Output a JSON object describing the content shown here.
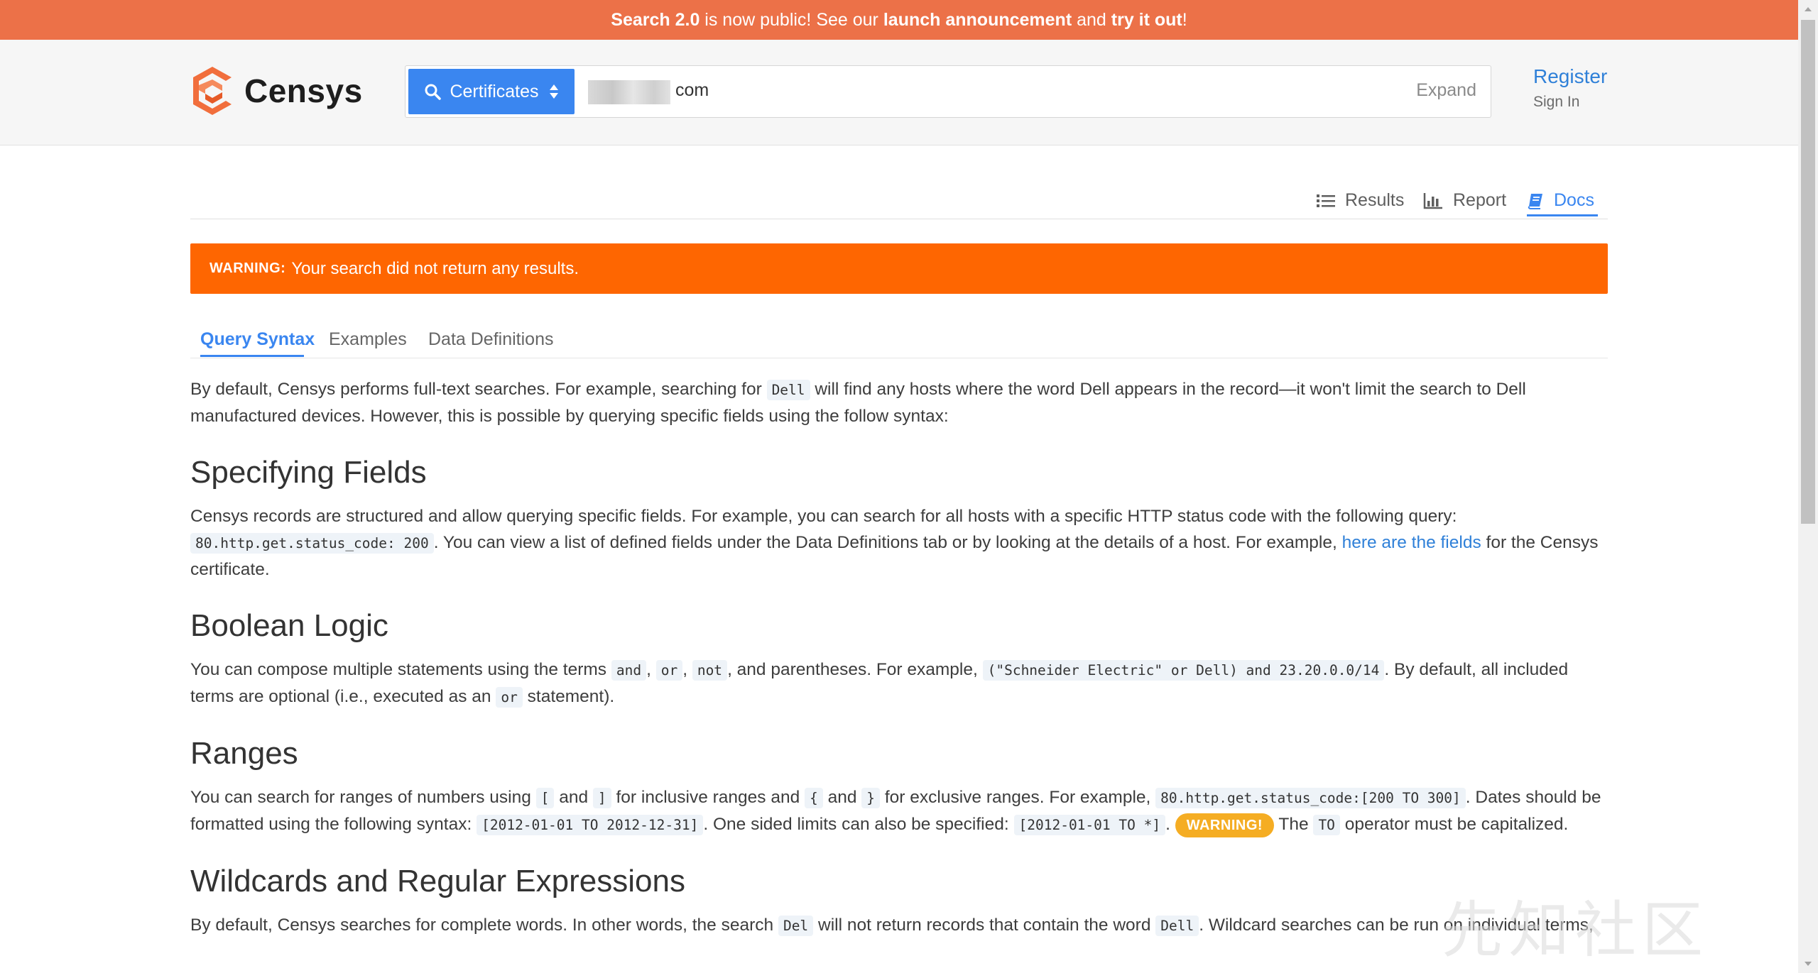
{
  "announcement": {
    "part1": "Search 2.0",
    "part2": " is now public! See our ",
    "part3": "launch announcement",
    "part4": " and ",
    "part5": "try it out",
    "part6": "!"
  },
  "header": {
    "brand": "Censys",
    "search_type": "Certificates",
    "search_value": "com",
    "expand_label": "Expand",
    "register_label": "Register",
    "signin_label": "Sign In"
  },
  "view_tabs": [
    {
      "label": "Results",
      "icon": "list-icon"
    },
    {
      "label": "Report",
      "icon": "bar-chart-icon"
    },
    {
      "label": "Docs",
      "icon": "book-icon"
    }
  ],
  "warning": {
    "label": "WARNING:",
    "text": "Your search did not return any results."
  },
  "doc_tabs": [
    {
      "label": "Query Syntax",
      "active": true
    },
    {
      "label": "Examples",
      "active": false
    },
    {
      "label": "Data Definitions",
      "active": false
    }
  ],
  "intro": {
    "t1": "By default, Censys performs full-text searches. For example, searching for ",
    "c1": "Dell",
    "t2": " will find any hosts where the word Dell appears in the record—it won't limit the search to Dell manufactured devices. However, this is possible by querying specific fields using the follow syntax:"
  },
  "specifying_fields": {
    "heading": "Specifying Fields",
    "t1": "Censys records are structured and allow querying specific fields. For example, you can search for all hosts with a specific HTTP status code with the following query:",
    "c1": "80.http.get.status_code: 200",
    "t2": ". You can view a list of defined fields under the Data Definitions tab or by looking at the details of a host. For example, ",
    "link": "here are the fields",
    "t3": " for the Censys certificate."
  },
  "boolean_logic": {
    "heading": "Boolean Logic",
    "t1": "You can compose multiple statements using the terms ",
    "c_and": "and",
    "c_or": "or",
    "c_not": "not",
    "t2": ", and parentheses. For example, ",
    "c_example": "(\"Schneider Electric\" or Dell) and 23.20.0.0/14",
    "t3": ". By default, all included terms are optional (i.e., executed as an ",
    "c_or2": "or",
    "t4": " statement)."
  },
  "ranges": {
    "heading": "Ranges",
    "t1": "You can search for ranges of numbers using ",
    "c_lb": "[",
    "t_and1": " and ",
    "c_rb": "]",
    "t2": " for inclusive ranges and ",
    "c_lc": "{",
    "t_and2": " and ",
    "c_rc": "}",
    "t3": " for exclusive ranges. For example, ",
    "c_ex": "80.http.get.status_code:[200 TO 300]",
    "t4": ". Dates should be formatted using the following syntax: ",
    "c_dates": "[2012-01-01 TO 2012-12-31]",
    "t5": ". One sided limits can also be specified: ",
    "c_onesided": "[2012-01-01 TO *]",
    "t6": ". ",
    "badge": "WARNING!",
    "t7": " The ",
    "c_to": "TO",
    "t8": " operator must be capitalized."
  },
  "wildcards": {
    "heading": "Wildcards and Regular Expressions",
    "t1": "By default, Censys searches for complete words. In other words, the search ",
    "c_del": "Del",
    "t2": " will not return records that contain the word ",
    "c_dell": "Dell",
    "t3": ". Wildcard searches can be run on individual terms,"
  },
  "watermark": "先知社区"
}
